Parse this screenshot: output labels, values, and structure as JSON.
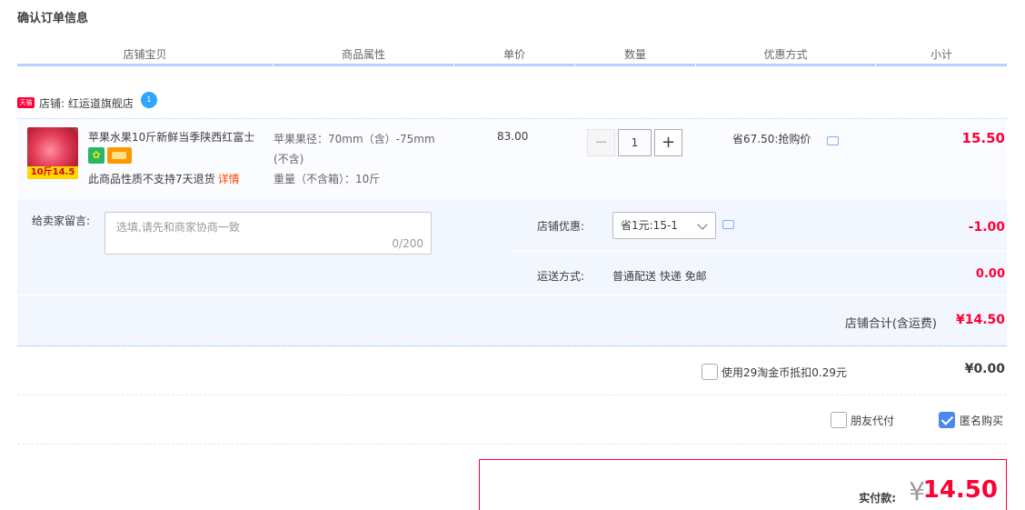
{
  "page_title": "确认订单信息",
  "columns": [
    "店铺宝贝",
    "商品属性",
    "单价",
    "数量",
    "优惠方式",
    "小计"
  ],
  "shop": {
    "tag": "天猫",
    "label": "店铺: 红运道旗舰店",
    "ww_badge": "1"
  },
  "item": {
    "thumb_tag": "10斤14.5",
    "title": "苹果水果10斤新鲜当季陕西红富士",
    "no_return": "此商品性质不支持7天退货",
    "detail_link": "详情",
    "attr_line1": "苹果果径：70mm（含）-75mm",
    "attr_line2": "(不含)",
    "attr_line3": "重量（不含箱）：10斤",
    "unit_price": "83.00",
    "quantity": "1",
    "minus": "−",
    "plus": "+",
    "promo": "省67.50:抢购价",
    "subtotal": "15.50"
  },
  "message": {
    "label": "给卖家留言:",
    "placeholder": "选填,请先和商家协商一致",
    "count": "0/200"
  },
  "coupon": {
    "label": "店铺优惠:",
    "selected": "省1元:15-1",
    "amount": "-1.00"
  },
  "shipping": {
    "label": "运送方式:",
    "value": "普通配送 快递 免邮",
    "amount": "0.00"
  },
  "shop_total": {
    "label": "店铺合计(含运费)",
    "value": "¥14.50"
  },
  "coins": {
    "label": "使用29淘金币抵扣0.29元",
    "checked": false,
    "amount": "¥0.00"
  },
  "options": {
    "friend_pay": {
      "label": "朋友代付",
      "checked": false
    },
    "anonymous": {
      "label": "匿名购买",
      "checked": true
    }
  },
  "payment": {
    "label": "实付款:",
    "yen": "¥",
    "amount": "14.50"
  },
  "colors": {
    "accent_red": "#ff0036",
    "header_line": "#b2d1ff",
    "panel_bg": "#f2f7ff",
    "checkbox_blue": "#4c87f0"
  }
}
